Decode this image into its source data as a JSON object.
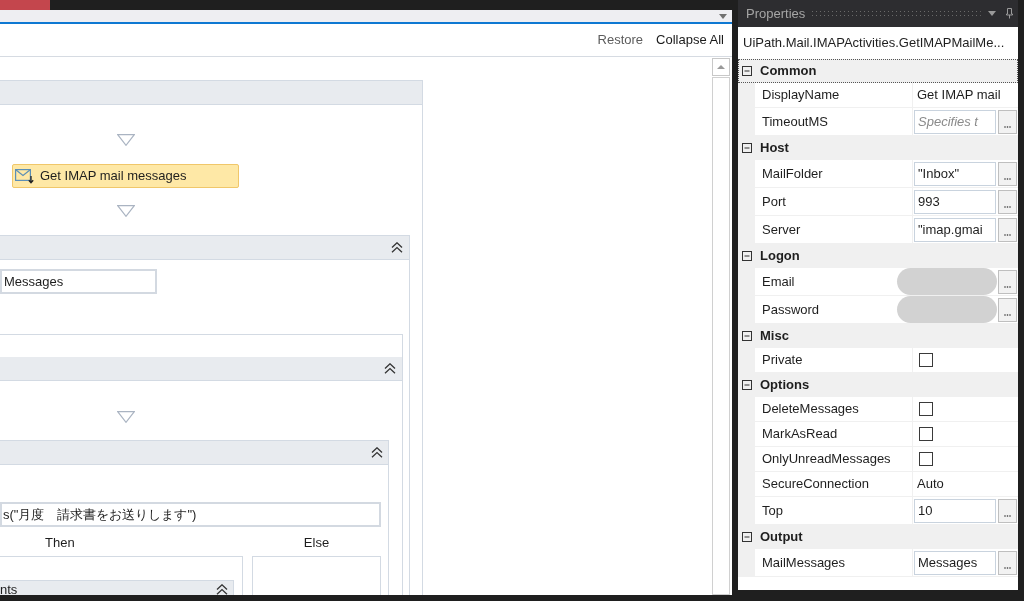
{
  "designer_toolbar": {
    "buttons": [
      {
        "label": "Restore",
        "disabled": true
      },
      {
        "label": "Collapse All",
        "disabled": false
      }
    ]
  },
  "workflow": {
    "activity": {
      "label": "Get IMAP mail messages"
    },
    "output_field": {
      "value": "Messages"
    },
    "condition_field": {
      "value": "s(\"月度　請求書をお送りします\")"
    },
    "branches": [
      {
        "label": "Then"
      },
      {
        "label": "Else"
      }
    ],
    "nested_activity": {
      "title": "nts"
    }
  },
  "properties": {
    "title": "Properties",
    "type_name": "UiPath.Mail.IMAPActivities.GetIMAPMailMe...",
    "categories": [
      {
        "name": "Common",
        "expanded": true,
        "focused": true,
        "rows": [
          {
            "name": "DisplayName",
            "kind": "text",
            "value": "Get IMAP mail"
          },
          {
            "name": "TimeoutMS",
            "kind": "field",
            "placeholder": "Specifies t"
          }
        ]
      },
      {
        "name": "Host",
        "expanded": true,
        "focused": false,
        "rows": [
          {
            "name": "MailFolder",
            "kind": "field",
            "value": "\"Inbox\""
          },
          {
            "name": "Port",
            "kind": "field",
            "value": "993"
          },
          {
            "name": "Server",
            "kind": "field",
            "value": "\"imap.gmai"
          }
        ]
      },
      {
        "name": "Logon",
        "expanded": true,
        "focused": false,
        "rows": [
          {
            "name": "Email",
            "kind": "redacted"
          },
          {
            "name": "Password",
            "kind": "redacted"
          }
        ]
      },
      {
        "name": "Misc",
        "expanded": true,
        "focused": false,
        "rows": [
          {
            "name": "Private",
            "kind": "checkbox",
            "checked": false
          }
        ]
      },
      {
        "name": "Options",
        "expanded": true,
        "focused": false,
        "rows": [
          {
            "name": "DeleteMessages",
            "kind": "checkbox",
            "checked": false
          },
          {
            "name": "MarkAsRead",
            "kind": "checkbox",
            "checked": false
          },
          {
            "name": "OnlyUnreadMessages",
            "kind": "checkbox",
            "checked": false
          },
          {
            "name": "SecureConnection",
            "kind": "text",
            "value": "Auto"
          },
          {
            "name": "Top",
            "kind": "field",
            "value": "10"
          }
        ]
      },
      {
        "name": "Output",
        "expanded": true,
        "focused": false,
        "rows": [
          {
            "name": "MailMessages",
            "kind": "field",
            "value": "Messages"
          }
        ]
      }
    ]
  }
}
